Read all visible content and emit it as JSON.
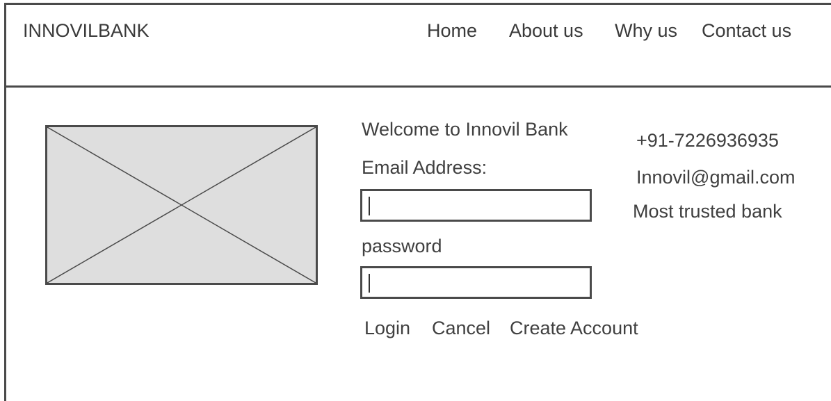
{
  "header": {
    "brand": "INNOVILBANK",
    "nav": {
      "home": "Home",
      "about": "About us",
      "why": "Why us",
      "contact": "Contact us"
    }
  },
  "login": {
    "welcome": "Welcome to Innovil Bank",
    "email_label": "Email Address:",
    "email_value": "",
    "password_label": "password",
    "password_value": "",
    "actions": {
      "login": "Login",
      "cancel": "Cancel",
      "create_account": "Create Account"
    }
  },
  "contact_info": {
    "phone": "+91-7226936935",
    "email": "Innovil@gmail.com",
    "tagline": "Most trusted bank"
  },
  "colors": {
    "border": "#4a4a4a",
    "placeholder_fill": "#dedede",
    "text": "#404040"
  },
  "icons": {
    "hero_image": "image-placeholder-icon"
  }
}
